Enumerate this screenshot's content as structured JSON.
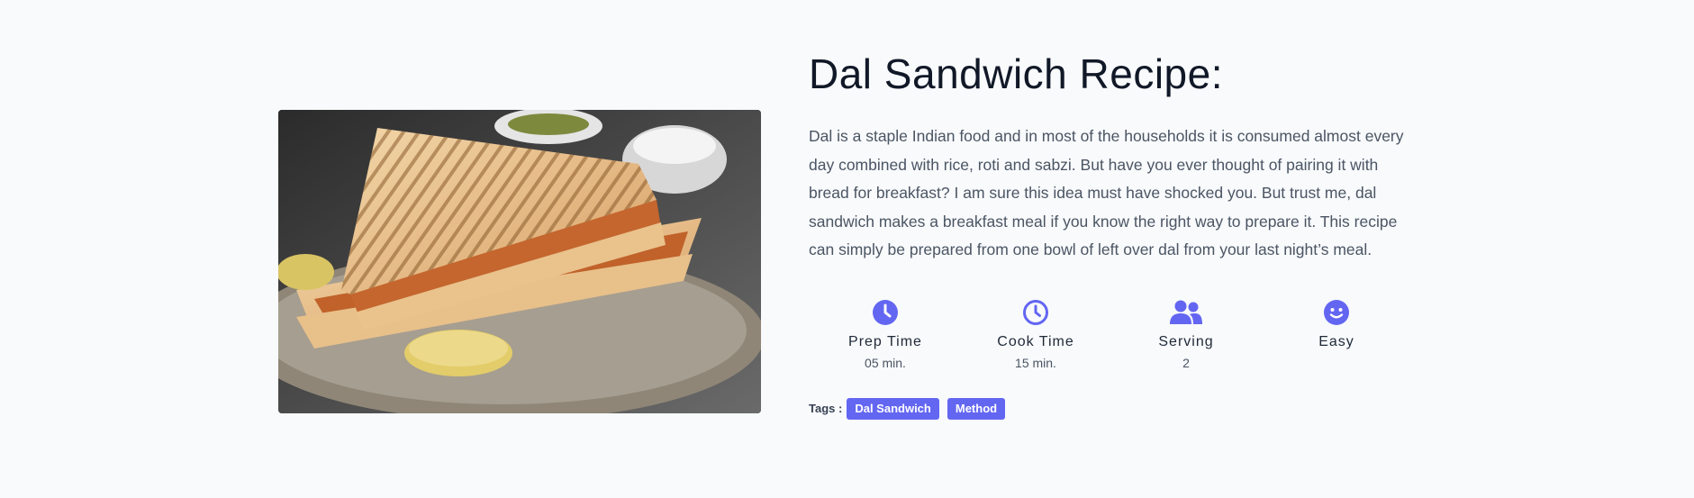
{
  "recipe": {
    "title": "Dal Sandwich Recipe:",
    "description": "Dal is a staple Indian food and in most of the households it is consumed almost every day combined with rice, roti and sabzi. But have you ever thought of pairing it with bread for breakfast? I am sure this idea must have shocked you. But trust me, dal sandwich makes a breakfast meal if you know the right way to prepare it. This recipe can simply be prepared from one bowl of left over dal from your last night’s meal."
  },
  "stats": [
    {
      "icon": "clock-solid-icon",
      "label": "Prep Time",
      "value": "05 min."
    },
    {
      "icon": "clock-outline-icon",
      "label": "Cook Time",
      "value": "15 min."
    },
    {
      "icon": "users-icon",
      "label": "Serving",
      "value": "2"
    },
    {
      "icon": "smile-icon",
      "label": "Easy",
      "value": ""
    }
  ],
  "tags": {
    "label": "Tags :",
    "items": [
      "Dal Sandwich",
      "Method"
    ]
  },
  "colors": {
    "accent": "#6366f1",
    "background": "#f8fafc",
    "title": "#111827",
    "body_text": "#4b5563"
  }
}
